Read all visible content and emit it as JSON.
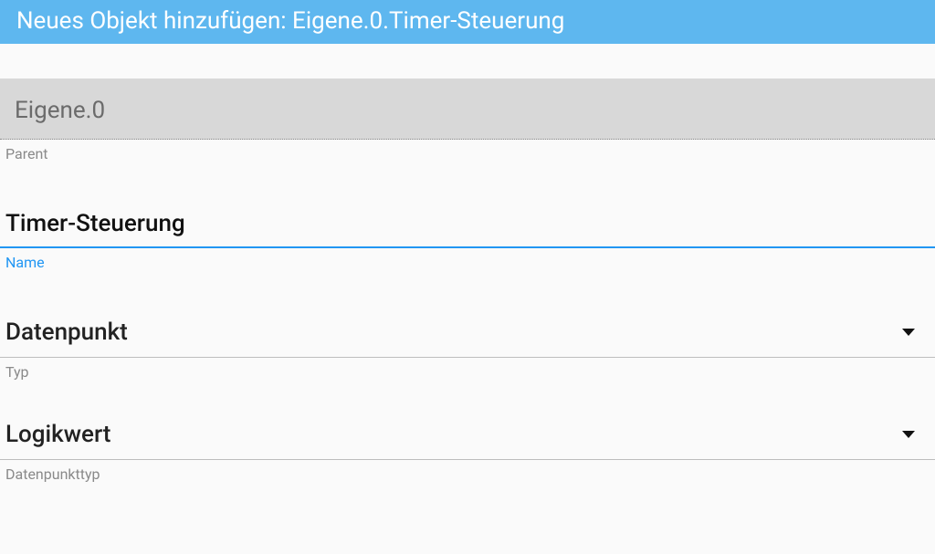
{
  "dialog": {
    "title": "Neues Objekt hinzufügen: Eigene.0.Timer-Steuerung"
  },
  "fields": {
    "parent": {
      "value": "Eigene.0",
      "label": "Parent"
    },
    "name": {
      "value": "Timer-Steuerung",
      "label": "Name"
    },
    "type": {
      "value": "Datenpunkt",
      "label": "Typ"
    },
    "datatype": {
      "value": "Logikwert",
      "label": "Datenpunkttyp"
    }
  }
}
